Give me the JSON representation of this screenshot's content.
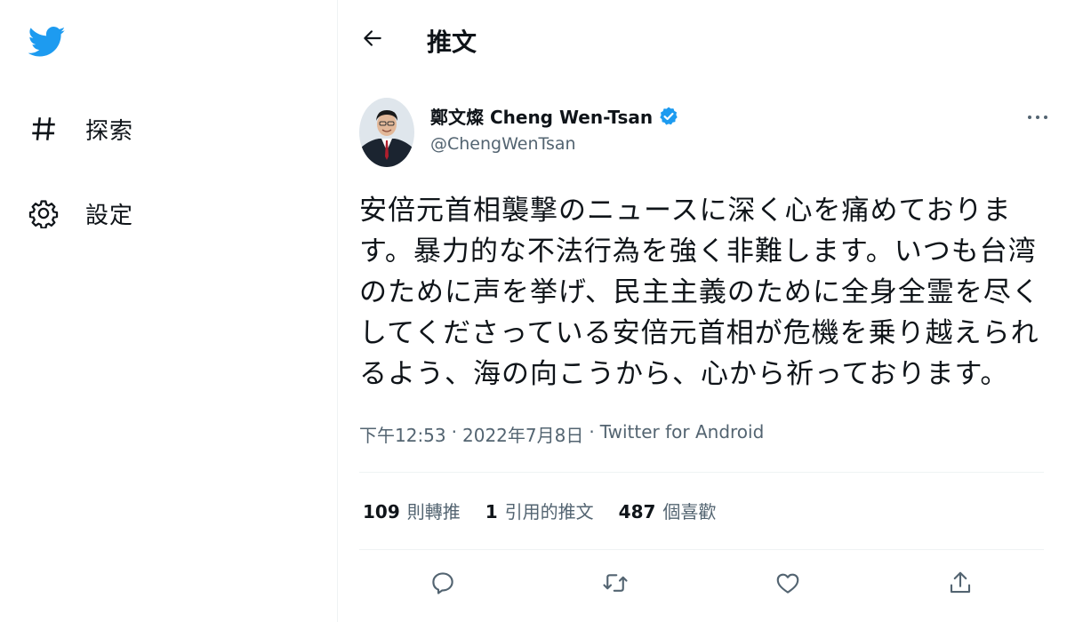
{
  "sidebar": {
    "logo_icon": "twitter-bird-icon",
    "brand_color": "#1d9bf0",
    "items": [
      {
        "icon": "hashtag-icon",
        "label": "探索"
      },
      {
        "icon": "gear-icon",
        "label": "設定"
      }
    ]
  },
  "header": {
    "back_icon": "arrow-left-icon",
    "title": "推文"
  },
  "tweet": {
    "author": {
      "name": "鄭文燦 Cheng Wen-Tsan",
      "handle": "@ChengWenTsan",
      "verified": true,
      "verified_color": "#1d9bf0"
    },
    "more_icon": "more-horizontal-icon",
    "text": "安倍元首相襲撃のニュースに深く心を痛めております。暴力的な不法行為を強く非難します。いつも台湾のために声を挙げ、民主主義のために全身全霊を尽くしてくださっている安倍元首相が危機を乗り越えられるよう、海の向こうから、心から祈っております。",
    "meta": {
      "time": "下午12:53",
      "separator": "·",
      "date": "2022年7月8日",
      "source": "Twitter for Android"
    },
    "stats": [
      {
        "count": "109",
        "label": "則轉推"
      },
      {
        "count": "1",
        "label": "引用的推文"
      },
      {
        "count": "487",
        "label": "個喜歡"
      }
    ],
    "actions": [
      {
        "icon": "reply-icon"
      },
      {
        "icon": "retweet-icon"
      },
      {
        "icon": "heart-icon"
      },
      {
        "icon": "share-icon"
      }
    ]
  },
  "colors": {
    "text_primary": "#0f1419",
    "text_secondary": "#536471",
    "divider": "#eff3f4"
  }
}
